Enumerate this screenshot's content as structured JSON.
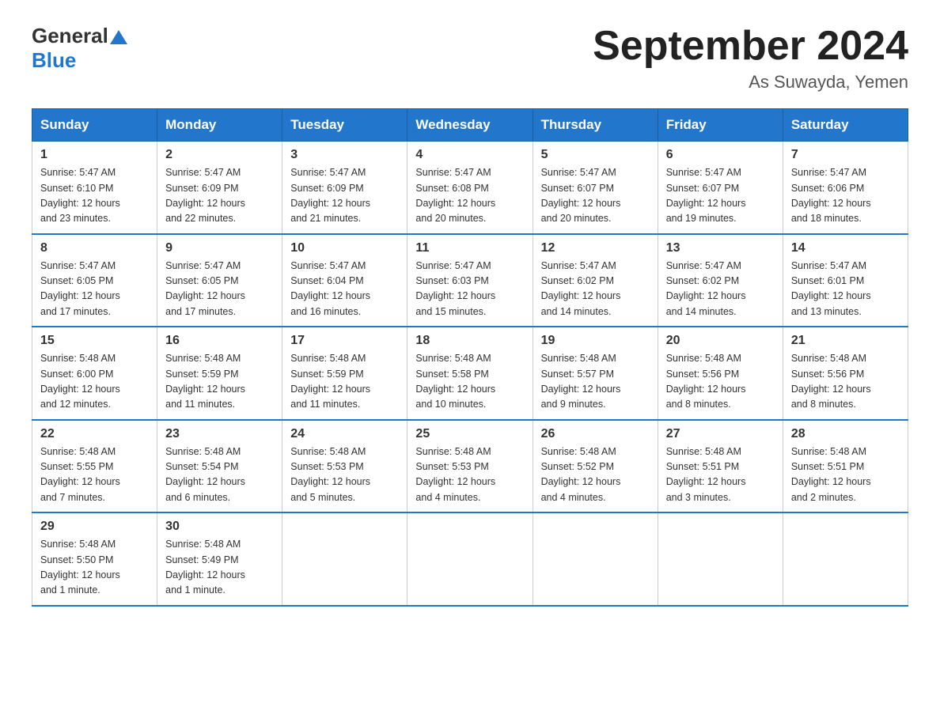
{
  "header": {
    "logo_general": "General",
    "logo_blue": "Blue",
    "month_year": "September 2024",
    "location": "As Suwayda, Yemen"
  },
  "days_of_week": [
    "Sunday",
    "Monday",
    "Tuesday",
    "Wednesday",
    "Thursday",
    "Friday",
    "Saturday"
  ],
  "weeks": [
    [
      {
        "day": "1",
        "sunrise": "5:47 AM",
        "sunset": "6:10 PM",
        "daylight": "12 hours and 23 minutes."
      },
      {
        "day": "2",
        "sunrise": "5:47 AM",
        "sunset": "6:09 PM",
        "daylight": "12 hours and 22 minutes."
      },
      {
        "day": "3",
        "sunrise": "5:47 AM",
        "sunset": "6:09 PM",
        "daylight": "12 hours and 21 minutes."
      },
      {
        "day": "4",
        "sunrise": "5:47 AM",
        "sunset": "6:08 PM",
        "daylight": "12 hours and 20 minutes."
      },
      {
        "day": "5",
        "sunrise": "5:47 AM",
        "sunset": "6:07 PM",
        "daylight": "12 hours and 20 minutes."
      },
      {
        "day": "6",
        "sunrise": "5:47 AM",
        "sunset": "6:07 PM",
        "daylight": "12 hours and 19 minutes."
      },
      {
        "day": "7",
        "sunrise": "5:47 AM",
        "sunset": "6:06 PM",
        "daylight": "12 hours and 18 minutes."
      }
    ],
    [
      {
        "day": "8",
        "sunrise": "5:47 AM",
        "sunset": "6:05 PM",
        "daylight": "12 hours and 17 minutes."
      },
      {
        "day": "9",
        "sunrise": "5:47 AM",
        "sunset": "6:05 PM",
        "daylight": "12 hours and 17 minutes."
      },
      {
        "day": "10",
        "sunrise": "5:47 AM",
        "sunset": "6:04 PM",
        "daylight": "12 hours and 16 minutes."
      },
      {
        "day": "11",
        "sunrise": "5:47 AM",
        "sunset": "6:03 PM",
        "daylight": "12 hours and 15 minutes."
      },
      {
        "day": "12",
        "sunrise": "5:47 AM",
        "sunset": "6:02 PM",
        "daylight": "12 hours and 14 minutes."
      },
      {
        "day": "13",
        "sunrise": "5:47 AM",
        "sunset": "6:02 PM",
        "daylight": "12 hours and 14 minutes."
      },
      {
        "day": "14",
        "sunrise": "5:47 AM",
        "sunset": "6:01 PM",
        "daylight": "12 hours and 13 minutes."
      }
    ],
    [
      {
        "day": "15",
        "sunrise": "5:48 AM",
        "sunset": "6:00 PM",
        "daylight": "12 hours and 12 minutes."
      },
      {
        "day": "16",
        "sunrise": "5:48 AM",
        "sunset": "5:59 PM",
        "daylight": "12 hours and 11 minutes."
      },
      {
        "day": "17",
        "sunrise": "5:48 AM",
        "sunset": "5:59 PM",
        "daylight": "12 hours and 11 minutes."
      },
      {
        "day": "18",
        "sunrise": "5:48 AM",
        "sunset": "5:58 PM",
        "daylight": "12 hours and 10 minutes."
      },
      {
        "day": "19",
        "sunrise": "5:48 AM",
        "sunset": "5:57 PM",
        "daylight": "12 hours and 9 minutes."
      },
      {
        "day": "20",
        "sunrise": "5:48 AM",
        "sunset": "5:56 PM",
        "daylight": "12 hours and 8 minutes."
      },
      {
        "day": "21",
        "sunrise": "5:48 AM",
        "sunset": "5:56 PM",
        "daylight": "12 hours and 8 minutes."
      }
    ],
    [
      {
        "day": "22",
        "sunrise": "5:48 AM",
        "sunset": "5:55 PM",
        "daylight": "12 hours and 7 minutes."
      },
      {
        "day": "23",
        "sunrise": "5:48 AM",
        "sunset": "5:54 PM",
        "daylight": "12 hours and 6 minutes."
      },
      {
        "day": "24",
        "sunrise": "5:48 AM",
        "sunset": "5:53 PM",
        "daylight": "12 hours and 5 minutes."
      },
      {
        "day": "25",
        "sunrise": "5:48 AM",
        "sunset": "5:53 PM",
        "daylight": "12 hours and 4 minutes."
      },
      {
        "day": "26",
        "sunrise": "5:48 AM",
        "sunset": "5:52 PM",
        "daylight": "12 hours and 4 minutes."
      },
      {
        "day": "27",
        "sunrise": "5:48 AM",
        "sunset": "5:51 PM",
        "daylight": "12 hours and 3 minutes."
      },
      {
        "day": "28",
        "sunrise": "5:48 AM",
        "sunset": "5:51 PM",
        "daylight": "12 hours and 2 minutes."
      }
    ],
    [
      {
        "day": "29",
        "sunrise": "5:48 AM",
        "sunset": "5:50 PM",
        "daylight": "12 hours and 1 minute."
      },
      {
        "day": "30",
        "sunrise": "5:48 AM",
        "sunset": "5:49 PM",
        "daylight": "12 hours and 1 minute."
      },
      null,
      null,
      null,
      null,
      null
    ]
  ],
  "labels": {
    "sunrise": "Sunrise:",
    "sunset": "Sunset:",
    "daylight": "Daylight:"
  }
}
